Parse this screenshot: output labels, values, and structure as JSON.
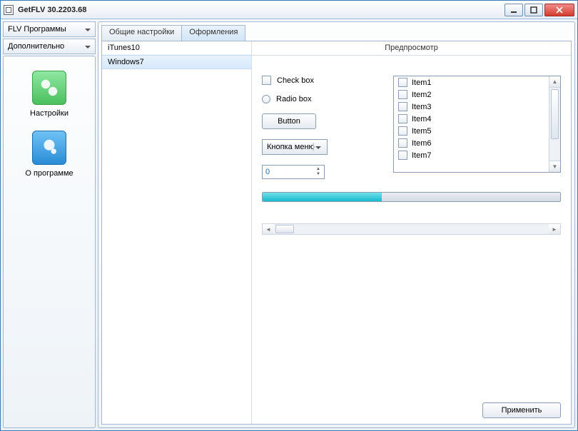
{
  "window": {
    "title": "GetFLV 30.2203.68"
  },
  "sidebar": {
    "select1": "FLV Программы",
    "select2": "Дополнительно",
    "nav": [
      {
        "label": "Настройки"
      },
      {
        "label": "О программе"
      }
    ]
  },
  "tabs": [
    {
      "label": "Общие настройки",
      "active": false
    },
    {
      "label": "Оформления",
      "active": true
    }
  ],
  "themes": [
    {
      "name": "iTunes10",
      "selected": false
    },
    {
      "name": "Windows7",
      "selected": true
    }
  ],
  "preview": {
    "header": "Предпросмотр",
    "checkbox_label": "Check box",
    "radio_label": "Radio box",
    "button_label": "Button",
    "dropdown_label": "Кнопка меню",
    "spinner_value": "0",
    "list_items": [
      "Item1",
      "Item2",
      "Item3",
      "Item4",
      "Item5",
      "Item6",
      "Item7"
    ],
    "progress_percent": 40
  },
  "footer": {
    "apply": "Применить"
  }
}
